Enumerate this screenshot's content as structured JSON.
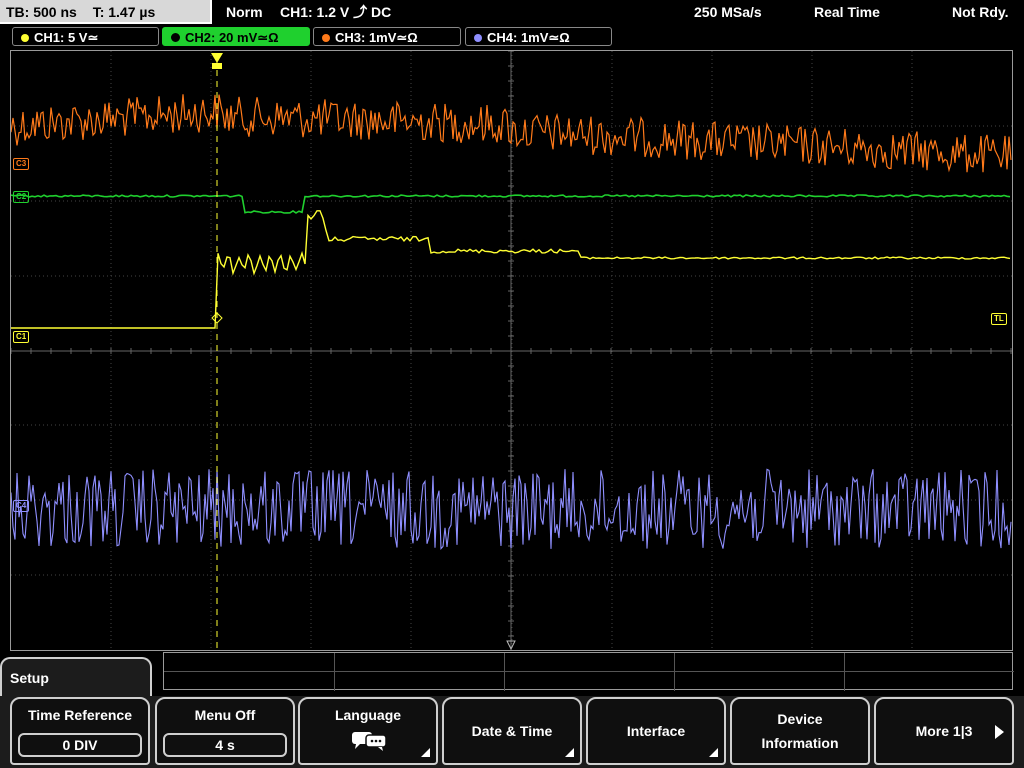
{
  "topbar": {
    "timebase": "TB: 500 ns",
    "trigger_time": "T: 1.47 µs",
    "mode": "Norm",
    "trigger_info": "CH1: 1.2 V ⤴ DC",
    "sample_rate": "250 MSa/s",
    "acq_mode": "Real Time",
    "status": "Not Rdy."
  },
  "channels": [
    {
      "label": "CH1: 5 V≃",
      "color": "#ffff33",
      "active": false
    },
    {
      "label": "CH2: 20 mV≃Ω",
      "color": "#1fd02e",
      "active": true
    },
    {
      "label": "CH3: 1mV≃Ω",
      "color": "#ff7a1a",
      "active": false
    },
    {
      "label": "CH4: 1mV≃Ω",
      "color": "#8f8fff",
      "active": false
    }
  ],
  "markers": {
    "c1": "C1",
    "c2": "C2",
    "c3": "C3",
    "c4": "C4",
    "trig_level": "TL"
  },
  "menu": {
    "title": "Setup",
    "keys": [
      {
        "label": "Time Reference",
        "value": "0 DIV"
      },
      {
        "label": "Menu Off",
        "value": "4 s"
      },
      {
        "label": "Language"
      },
      {
        "label": "Date & Time"
      },
      {
        "label": "Interface"
      },
      {
        "label": "Device Information"
      },
      {
        "label": "More 1|3"
      }
    ]
  },
  "colors": {
    "ch1": "#ffff33",
    "ch2": "#1fd02e",
    "ch3": "#ff7a1a",
    "ch4": "#8f8fff",
    "grid": "#4a4a4a"
  }
}
